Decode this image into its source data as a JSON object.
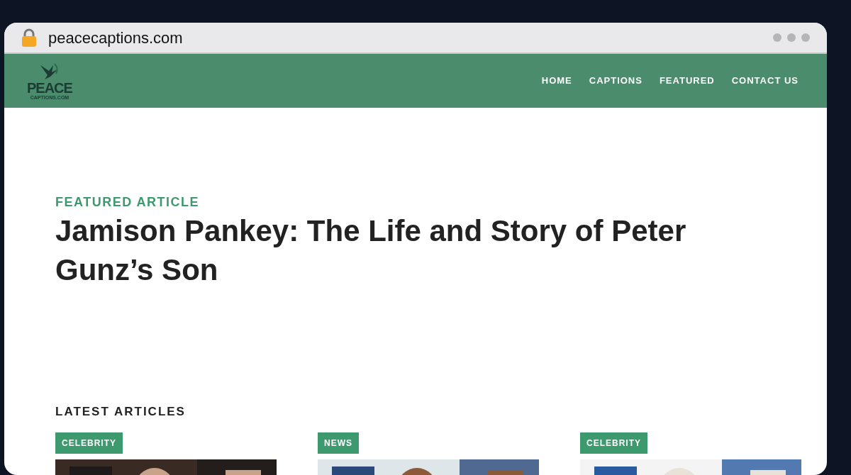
{
  "browser": {
    "url": "peacecaptions.com"
  },
  "site": {
    "logo_title": "PEACE",
    "logo_subtitle": "CAPTIONS.COM",
    "nav": [
      {
        "label": "HOME"
      },
      {
        "label": "CAPTIONS"
      },
      {
        "label": "FEATURED"
      },
      {
        "label": "CONTACT US"
      }
    ]
  },
  "featured": {
    "eyebrow": "FEATURED ARTICLE",
    "title": "Jamison Pankey: The Life and Story of Peter Gunz’s Son"
  },
  "latest": {
    "heading": "LATEST ARTICLES",
    "articles": [
      {
        "category": "CELEBRITY"
      },
      {
        "category": "NEWS"
      },
      {
        "category": "CELEBRITY"
      }
    ]
  }
}
